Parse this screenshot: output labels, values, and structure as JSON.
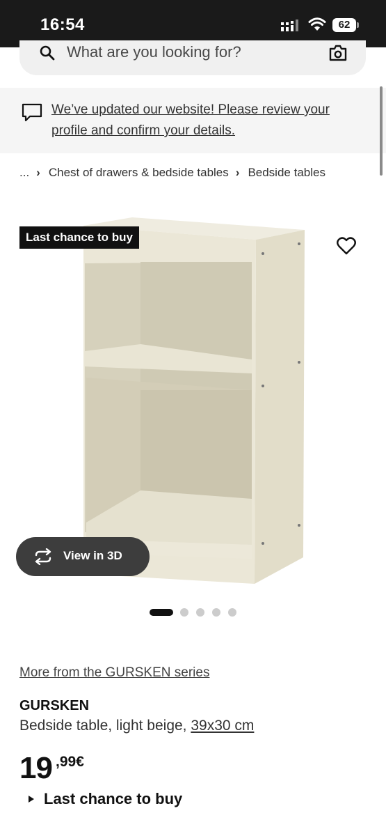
{
  "status_bar": {
    "time": "16:54",
    "battery": "62",
    "icons": [
      "signal-icon",
      "wifi-icon",
      "battery-icon"
    ]
  },
  "search": {
    "placeholder": "What are you looking for?",
    "icons": [
      "search-icon",
      "camera-icon"
    ]
  },
  "notice": {
    "text": "We’ve updated our website! Please review your profile and confirm your details.",
    "icon": "chat-icon"
  },
  "breadcrumb": {
    "items": [
      "...",
      "Chest of drawers & bedside tables",
      "Bedside tables"
    ]
  },
  "product": {
    "badge": "Last chance to buy",
    "view_3d_label": "View in 3D",
    "gallery_count": 5,
    "gallery_active_index": 0,
    "series_link": "More from the GURSKEN series",
    "name": "GURSKEN",
    "description": "Bedside table, light beige,",
    "size": "39x30 cm",
    "price_integer": "19",
    "price_decimal": ",99€",
    "availability": "Last chance to buy"
  },
  "colors": {
    "status_bar_bg": "#1a1a1a",
    "badge_bg": "#111111",
    "shelf_color": "#e8e4d4",
    "view3d_bg": "#3d3d3d"
  }
}
